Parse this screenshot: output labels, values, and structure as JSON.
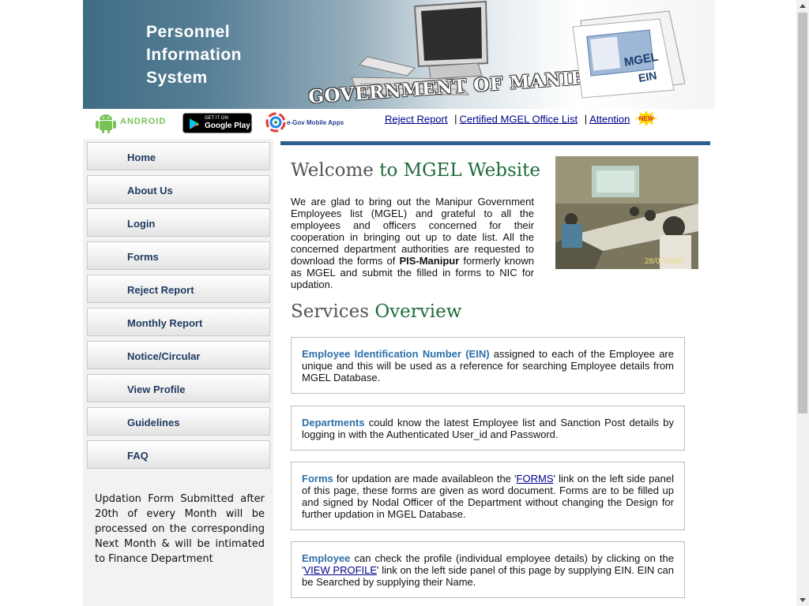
{
  "banner": {
    "title_line1": "Personnel",
    "title_line2": "Information",
    "title_line3": "System",
    "government": "GOVERNMENT OF MANIPUR",
    "card_line1": "MGEL",
    "card_line2": "EIN"
  },
  "apps": {
    "android": "ANDROID",
    "gplay_small": "GET IT ON",
    "gplay_big": "Google Play",
    "egov": "e-Gov Mobile Apps"
  },
  "toplinks": {
    "reject": "Reject Report",
    "certified": "Certified MGEL Office List",
    "attention": "Attention",
    "sep": "|",
    "new_badge": "NEW"
  },
  "sidebar": {
    "items": [
      {
        "label": "Home"
      },
      {
        "label": "About Us"
      },
      {
        "label": "Login"
      },
      {
        "label": "Forms"
      },
      {
        "label": "Reject Report"
      },
      {
        "label": "Monthly Report"
      },
      {
        "label": "Notice/Circular"
      },
      {
        "label": "View Profile"
      },
      {
        "label": "Guidelines"
      },
      {
        "label": "FAQ"
      }
    ],
    "notice": "Updation Form Submitted after 20th of every Month will be processed on the corresponding Next Month & will be intimated to Finance Department"
  },
  "main": {
    "welcome_prefix": "Welcome ",
    "welcome_accent": "to MGEL Website",
    "welcome_text_1": "We are glad to bring out the Manipur Government Employees list (MGEL) and grateful to all the employees and officers concerned for their cooperation in bringing out up to date list. All the concerned department authorities are requested to download the forms of ",
    "welcome_text_bold": "PIS-Manipur",
    "welcome_text_2": " formerly known as MGEL and submit the filled in forms to NIC for updation.",
    "photo_date": "28/07/2007",
    "services_prefix": "Services ",
    "services_accent": "Overview",
    "services": {
      "ein_lead": "Employee Identification Number (EIN)",
      "ein_text": " assigned to each of the Employee are unique and this will be used as a reference for searching Employee details from MGEL Database.",
      "dept_lead": "Departments",
      "dept_text": " could know the latest Employee list and Sanction Post details by logging in with the Authenticated User_id and Password.",
      "forms_lead": "Forms",
      "forms_text_1": " for updation are made availableon the '",
      "forms_link": "FORMS",
      "forms_text_2": "' link on the left side panel of this page, these forms are given as word document. Forms are to be filled up and signed by Nodal Officer of the Department without changing the Design for further updation in MGEL Database.",
      "emp_lead": "Employee",
      "emp_text_1": " can check the profile (individual employee details) by clicking on the '",
      "emp_link": "VIEW PROFILE",
      "emp_text_2": "' link on the left side panel of this page by supplying  EIN. EIN can be Searched by supplying their Name."
    }
  },
  "colors": {
    "nav_text": "#1e3a5f",
    "accent_green": "#1f6b3a",
    "service_lead": "#2e6fa8",
    "top_bar": "#2f5f8f"
  }
}
